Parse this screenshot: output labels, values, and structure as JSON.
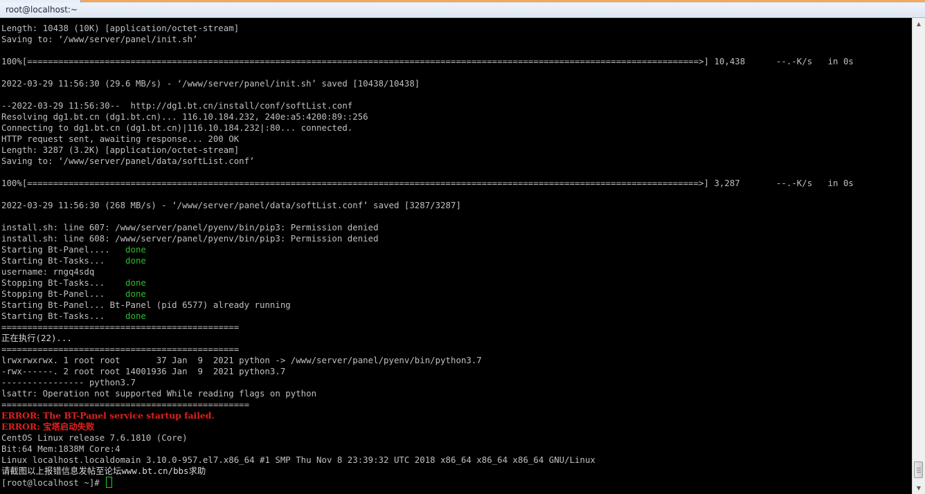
{
  "window": {
    "title": "root@localhost:~"
  },
  "terminal": {
    "lines": [
      [
        {
          "t": "Length: 10438 (10K) [application/octet-stream]"
        }
      ],
      [
        {
          "t": "Saving to: ‘/www/server/panel/init.sh’"
        }
      ],
      [
        {
          "t": ""
        }
      ],
      [
        {
          "t": "100%[==================================================================================================================================>] 10,438      --.-K/s   in 0s"
        }
      ],
      [
        {
          "t": ""
        }
      ],
      [
        {
          "t": "2022-03-29 11:56:30 (29.6 MB/s) - ‘/www/server/panel/init.sh’ saved [10438/10438]"
        }
      ],
      [
        {
          "t": ""
        }
      ],
      [
        {
          "t": "--2022-03-29 11:56:30--  http://dg1.bt.cn/install/conf/softList.conf"
        }
      ],
      [
        {
          "t": "Resolving dg1.bt.cn (dg1.bt.cn)... 116.10.184.232, 240e:a5:4200:89::256"
        }
      ],
      [
        {
          "t": "Connecting to dg1.bt.cn (dg1.bt.cn)|116.10.184.232|:80... connected."
        }
      ],
      [
        {
          "t": "HTTP request sent, awaiting response... 200 OK"
        }
      ],
      [
        {
          "t": "Length: 3287 (3.2K) [application/octet-stream]"
        }
      ],
      [
        {
          "t": "Saving to: ‘/www/server/panel/data/softList.conf’"
        }
      ],
      [
        {
          "t": ""
        }
      ],
      [
        {
          "t": "100%[==================================================================================================================================>] 3,287       --.-K/s   in 0s"
        }
      ],
      [
        {
          "t": ""
        }
      ],
      [
        {
          "t": "2022-03-29 11:56:30 (268 MB/s) - ‘/www/server/panel/data/softList.conf’ saved [3287/3287]"
        }
      ],
      [
        {
          "t": ""
        }
      ],
      [
        {
          "t": "install.sh: line 607: /www/server/panel/pyenv/bin/pip3: Permission denied"
        }
      ],
      [
        {
          "t": "install.sh: line 608: /www/server/panel/pyenv/bin/pip3: Permission denied"
        }
      ],
      [
        {
          "t": "Starting Bt-Panel....   "
        },
        {
          "t": "done",
          "c": "green"
        }
      ],
      [
        {
          "t": "Starting Bt-Tasks...    "
        },
        {
          "t": "done",
          "c": "green"
        }
      ],
      [
        {
          "t": "username: rngq4sdq"
        }
      ],
      [
        {
          "t": "Stopping Bt-Tasks...    "
        },
        {
          "t": "done",
          "c": "green"
        }
      ],
      [
        {
          "t": "Stopping Bt-Panel...    "
        },
        {
          "t": "done",
          "c": "green"
        }
      ],
      [
        {
          "t": "Starting Bt-Panel... Bt-Panel (pid 6577) already running"
        }
      ],
      [
        {
          "t": "Starting Bt-Tasks...    "
        },
        {
          "t": "done",
          "c": "green"
        }
      ],
      [
        {
          "t": "=============================================="
        }
      ],
      [
        {
          "t": "正在执行(22)...",
          "c": "white"
        }
      ],
      [
        {
          "t": "=============================================="
        }
      ],
      [
        {
          "t": "lrwxrwxrwx. 1 root root       37 Jan  9  2021 python -> /www/server/panel/pyenv/bin/python3.7"
        }
      ],
      [
        {
          "t": "-rwx------. 2 root root 14001936 Jan  9  2021 python3.7"
        }
      ],
      [
        {
          "t": "---------------- python3.7"
        }
      ],
      [
        {
          "t": "lsattr: Operation not supported While reading flags on python"
        }
      ],
      [
        {
          "t": "================================================"
        }
      ],
      [
        {
          "t": "ERROR: The BT-Panel service startup failed.",
          "c": "red"
        }
      ],
      [
        {
          "t": "ERROR: 宝塔启动失败",
          "c": "red"
        }
      ],
      [
        {
          "t": "CentOS Linux release 7.6.1810 (Core)"
        }
      ],
      [
        {
          "t": "Bit:64 Mem:1838M Core:4"
        }
      ],
      [
        {
          "t": "Linux localhost.localdomain 3.10.0-957.el7.x86_64 #1 SMP Thu Nov 8 23:39:32 UTC 2018 x86_64 x86_64 x86_64 GNU/Linux"
        }
      ],
      [
        {
          "t": "请截图以上报错信息发帖至论坛www.bt.cn/bbs求助",
          "c": "white"
        }
      ]
    ],
    "prompt": "[root@localhost ~]# "
  },
  "icons": {
    "scroll_up": "▲",
    "scroll_down": "▼"
  },
  "colors": {
    "background": "#000000",
    "text": "#c0c0c0",
    "done": "#2dbd2d",
    "error": "#e02020",
    "cursor": "#1fd11f"
  }
}
